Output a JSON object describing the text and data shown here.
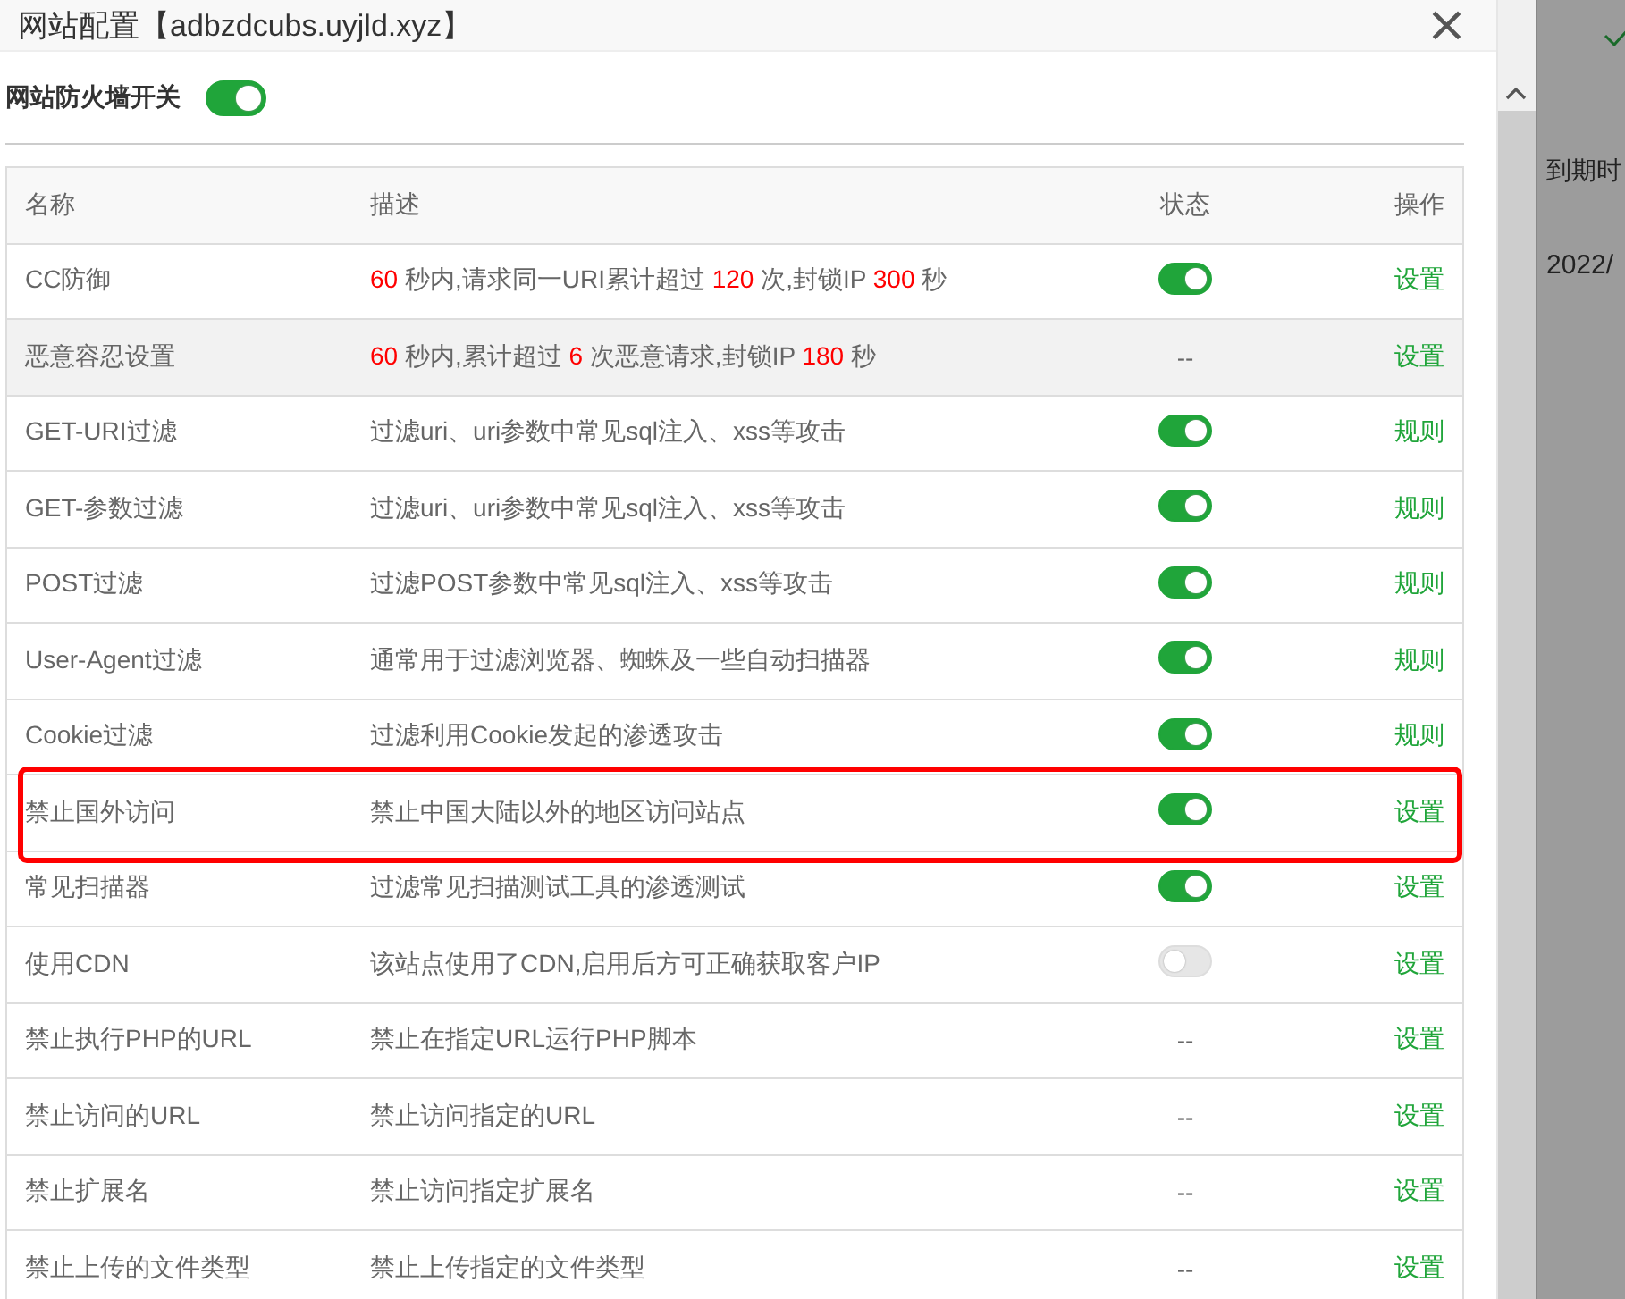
{
  "dialog": {
    "title": "网站配置【adbzdcubs.uyjld.xyz】",
    "close": "×"
  },
  "firewall": {
    "label": "网站防火墙开关",
    "on": true
  },
  "table": {
    "columns": [
      "名称",
      "描述",
      "状态",
      "操作"
    ],
    "rows": [
      {
        "name": "CC防御",
        "description": [
          {
            "text": "60",
            "red": true
          },
          {
            "text": " 秒内,请求同一URI累计超过 ",
            "red": false
          },
          {
            "text": "120",
            "red": true
          },
          {
            "text": " 次,封锁IP ",
            "red": false
          },
          {
            "text": "300",
            "red": true
          },
          {
            "text": " 秒",
            "red": false
          }
        ],
        "status": {
          "kind": "switch",
          "on": true
        },
        "action": "设置",
        "hovered": false,
        "highlighted": false
      },
      {
        "name": "恶意容忍设置",
        "description": [
          {
            "text": "60",
            "red": true
          },
          {
            "text": " 秒内,累计超过 ",
            "red": false
          },
          {
            "text": "6",
            "red": true
          },
          {
            "text": " 次恶意请求,封锁IP ",
            "red": false
          },
          {
            "text": "180",
            "red": true
          },
          {
            "text": " 秒",
            "red": false
          }
        ],
        "status": {
          "kind": "text",
          "text": "--"
        },
        "action": "设置",
        "hovered": true,
        "highlighted": false
      },
      {
        "name": "GET-URI过滤",
        "description": [
          {
            "text": "过滤uri、uri参数中常见sql注入、xss等攻击",
            "red": false
          }
        ],
        "status": {
          "kind": "switch",
          "on": true
        },
        "action": "规则",
        "hovered": false,
        "highlighted": false
      },
      {
        "name": "GET-参数过滤",
        "description": [
          {
            "text": "过滤uri、uri参数中常见sql注入、xss等攻击",
            "red": false
          }
        ],
        "status": {
          "kind": "switch",
          "on": true
        },
        "action": "规则",
        "hovered": false,
        "highlighted": false
      },
      {
        "name": "POST过滤",
        "description": [
          {
            "text": "过滤POST参数中常见sql注入、xss等攻击",
            "red": false
          }
        ],
        "status": {
          "kind": "switch",
          "on": true
        },
        "action": "规则",
        "hovered": false,
        "highlighted": false
      },
      {
        "name": "User-Agent过滤",
        "description": [
          {
            "text": "通常用于过滤浏览器、蜘蛛及一些自动扫描器",
            "red": false
          }
        ],
        "status": {
          "kind": "switch",
          "on": true
        },
        "action": "规则",
        "hovered": false,
        "highlighted": false
      },
      {
        "name": "Cookie过滤",
        "description": [
          {
            "text": "过滤利用Cookie发起的渗透攻击",
            "red": false
          }
        ],
        "status": {
          "kind": "switch",
          "on": true
        },
        "action": "规则",
        "hovered": false,
        "highlighted": false
      },
      {
        "name": "禁止国外访问",
        "description": [
          {
            "text": "禁止中国大陆以外的地区访问站点",
            "red": false
          }
        ],
        "status": {
          "kind": "switch",
          "on": true
        },
        "action": "设置",
        "hovered": false,
        "highlighted": true
      },
      {
        "name": "常见扫描器",
        "description": [
          {
            "text": "过滤常见扫描测试工具的渗透测试",
            "red": false
          }
        ],
        "status": {
          "kind": "switch",
          "on": true
        },
        "action": "设置",
        "hovered": false,
        "highlighted": false
      },
      {
        "name": "使用CDN",
        "description": [
          {
            "text": "该站点使用了CDN,启用后方可正确获取客户IP",
            "red": false
          }
        ],
        "status": {
          "kind": "switch",
          "on": false
        },
        "action": "设置",
        "hovered": false,
        "highlighted": false
      },
      {
        "name": "禁止执行PHP的URL",
        "description": [
          {
            "text": "禁止在指定URL运行PHP脚本",
            "red": false
          }
        ],
        "status": {
          "kind": "text",
          "text": "--"
        },
        "action": "设置",
        "hovered": false,
        "highlighted": false
      },
      {
        "name": "禁止访问的URL",
        "description": [
          {
            "text": "禁止访问指定的URL",
            "red": false
          }
        ],
        "status": {
          "kind": "text",
          "text": "--"
        },
        "action": "设置",
        "hovered": false,
        "highlighted": false
      },
      {
        "name": "禁止扩展名",
        "description": [
          {
            "text": "禁止访问指定扩展名",
            "red": false
          }
        ],
        "status": {
          "kind": "text",
          "text": "--"
        },
        "action": "设置",
        "hovered": false,
        "highlighted": false
      },
      {
        "name": "禁止上传的文件类型",
        "description": [
          {
            "text": "禁止上传指定的文件类型",
            "red": false
          }
        ],
        "status": {
          "kind": "text",
          "text": "--"
        },
        "action": "设置",
        "hovered": false,
        "highlighted": false
      }
    ]
  },
  "background": {
    "column_heading": "到期时",
    "date": "2022/"
  }
}
